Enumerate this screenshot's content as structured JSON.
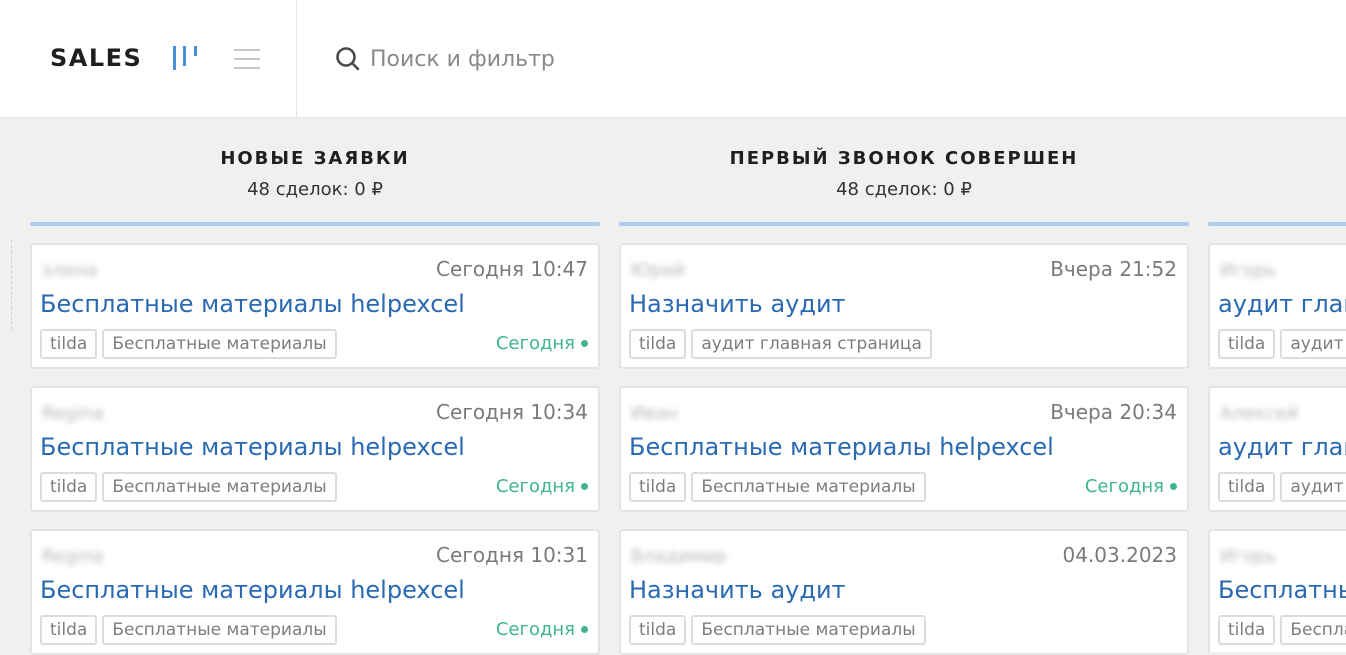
{
  "header": {
    "pipeline_title": "SALES",
    "search_placeholder": "Поиск и фильтр"
  },
  "colors": {
    "accent_blue": "#2a6ab3",
    "column_line": "#a9ccef",
    "task_green": "#3fb68a"
  },
  "columns": [
    {
      "title": "НОВЫЕ ЗАЯВКИ",
      "summary": "48 сделок: 0 ₽",
      "cards": [
        {
          "contact": "элена",
          "date": "Сегодня 10:47",
          "deal": "Бесплатные материалы helpexcel",
          "tags": [
            "tilda",
            "Бесплатные материалы"
          ],
          "task": "Сегодня"
        },
        {
          "contact": "Regina",
          "date": "Сегодня 10:34",
          "deal": "Бесплатные материалы helpexcel",
          "tags": [
            "tilda",
            "Бесплатные материалы"
          ],
          "task": "Сегодня"
        },
        {
          "contact": "Regina",
          "date": "Сегодня 10:31",
          "deal": "Бесплатные материалы helpexcel",
          "tags": [
            "tilda",
            "Бесплатные материалы"
          ],
          "task": "Сегодня"
        }
      ]
    },
    {
      "title": "ПЕРВЫЙ ЗВОНОК СОВЕРШЕН",
      "summary": "48 сделок: 0 ₽",
      "cards": [
        {
          "contact": "Юрий",
          "date": "Вчера 21:52",
          "deal": "Назначить аудит",
          "tags": [
            "tilda",
            "аудит главная страница"
          ],
          "task": ""
        },
        {
          "contact": "Иван",
          "date": "Вчера 20:34",
          "deal": "Бесплатные материалы helpexcel",
          "tags": [
            "tilda",
            "Бесплатные материалы"
          ],
          "task": "Сегодня"
        },
        {
          "contact": "Владимир",
          "date": "04.03.2023",
          "deal": "Назначить аудит",
          "tags": [
            "tilda",
            "Бесплатные материалы"
          ],
          "task": ""
        }
      ]
    },
    {
      "title": "",
      "summary": "",
      "cards": [
        {
          "contact": "Игорь",
          "date": "",
          "deal": "аудит главная страница",
          "tags": [
            "tilda",
            "аудит главная страница"
          ],
          "task": ""
        },
        {
          "contact": "Алексей",
          "date": "",
          "deal": "аудит главная страница",
          "tags": [
            "tilda",
            "аудит главная страница"
          ],
          "task": ""
        },
        {
          "contact": "Игорь",
          "date": "",
          "deal": "Бесплатные материалы helpexcel",
          "tags": [
            "tilda",
            "Бесплатные материалы"
          ],
          "task": ""
        }
      ]
    }
  ]
}
